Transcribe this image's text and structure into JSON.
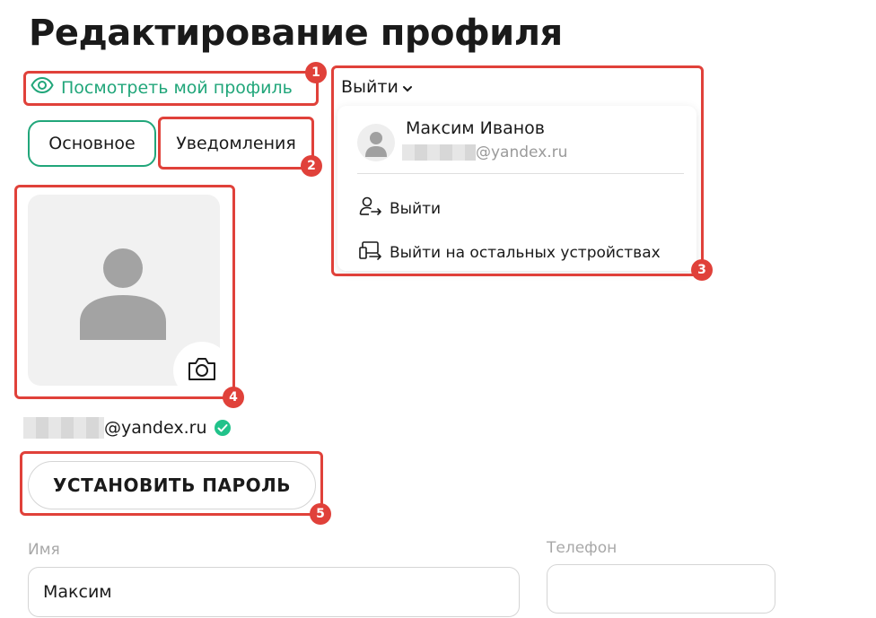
{
  "page": {
    "title": "Редактирование профиля",
    "view_profile_link": "Посмотреть мой профиль"
  },
  "tabs": [
    {
      "label": "Основное",
      "active": true
    },
    {
      "label": "Уведомления",
      "active": false
    }
  ],
  "logout_menu": {
    "trigger_label": "Выйти",
    "user_name": "Максим Иванов",
    "user_email_domain": "@yandex.ru",
    "items": [
      {
        "label": "Выйти",
        "icon": "user-logout-icon"
      },
      {
        "label": "Выйти на остальных устройствах",
        "icon": "devices-logout-icon"
      }
    ]
  },
  "avatar": {
    "placeholder_icon": "user-silhouette-icon",
    "camera_icon": "camera-icon"
  },
  "account": {
    "email_domain": "@yandex.ru",
    "verified_icon": "check-circle-icon"
  },
  "set_password_button": "УСТАНОВИТЬ ПАРОЛЬ",
  "form": {
    "name_label": "Имя",
    "name_value": "Максим",
    "phone_label": "Телефон",
    "phone_value": ""
  },
  "annotations": [
    "1",
    "2",
    "3",
    "4",
    "5"
  ],
  "colors": {
    "accent": "#21a67a",
    "annotation": "#e0413a"
  }
}
